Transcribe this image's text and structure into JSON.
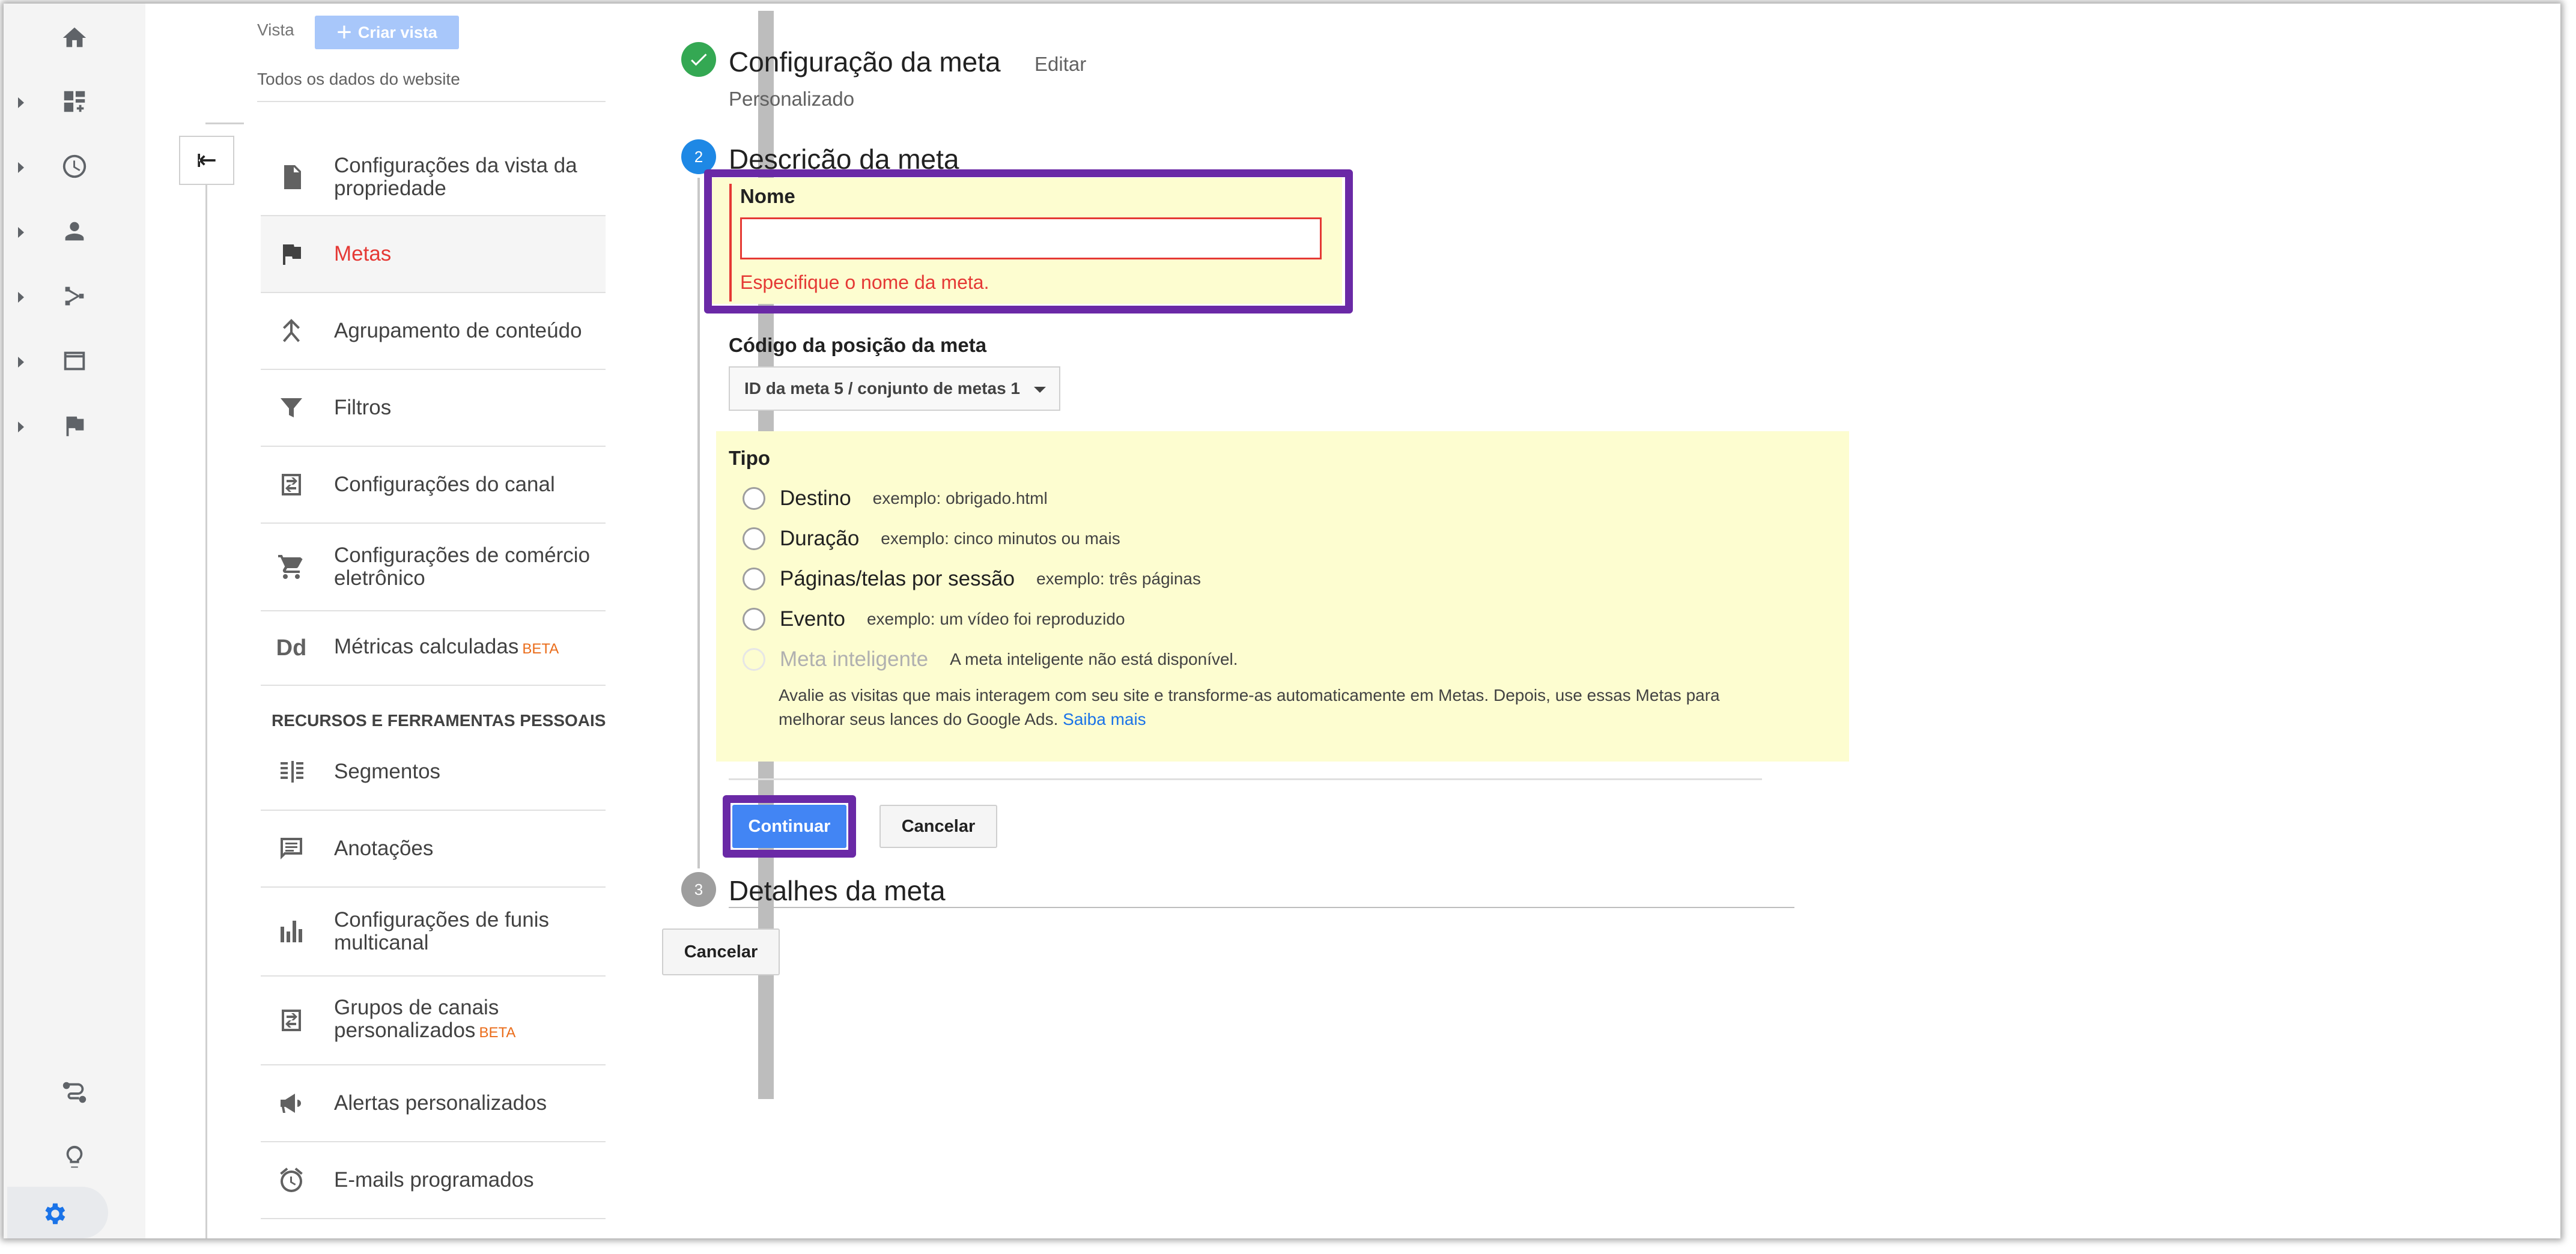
{
  "rail": {
    "icons": [
      "home-icon",
      "dashboard-icon",
      "clock-icon",
      "person-icon",
      "acquisition-icon",
      "behavior-icon",
      "flag-icon"
    ],
    "bottom_icons": [
      "route-icon",
      "lightbulb-icon",
      "gear-icon"
    ]
  },
  "admin": {
    "vista_label": "Vista",
    "criar_vista": "Criar vista",
    "view_name": "Todos os dados do website",
    "nav": [
      {
        "label": "Configurações da vista da propriedade",
        "icon": "document-icon"
      },
      {
        "label": "Metas",
        "icon": "flag-icon",
        "selected": true
      },
      {
        "label": "Agrupamento de conteúdo",
        "icon": "content-grouping-icon"
      },
      {
        "label": "Filtros",
        "icon": "filter-icon"
      },
      {
        "label": "Configurações do canal",
        "icon": "channel-icon"
      },
      {
        "label": "Configurações de comércio eletrônico",
        "icon": "cart-icon"
      },
      {
        "label": "Métricas calculadas",
        "icon": "dd-icon",
        "badge": "BETA"
      }
    ],
    "section_heading": "RECURSOS E FERRAMENTAS PESSOAIS",
    "personal": [
      {
        "label": "Segmentos",
        "icon": "segments-icon"
      },
      {
        "label": "Anotações",
        "icon": "annotations-icon"
      },
      {
        "label": "Configurações de funis multicanal",
        "icon": "bar-chart-icon"
      },
      {
        "label": "Grupos de canais personalizados",
        "icon": "channel-groups-icon",
        "badge": "BETA"
      },
      {
        "label": "Alertas personalizados",
        "icon": "megaphone-icon"
      },
      {
        "label": "E-mails programados",
        "icon": "alarm-clock-icon"
      }
    ]
  },
  "steps": {
    "step1": {
      "title": "Configuração da meta",
      "edit": "Editar",
      "subtitle": "Personalizado"
    },
    "step2": {
      "number": "2",
      "title": "Descrição da meta"
    },
    "step3": {
      "number": "3",
      "title": "Detalhes da meta"
    }
  },
  "form": {
    "nome_label": "Nome",
    "nome_value": "",
    "nome_error": "Especifique o nome da meta.",
    "codigo_label": "Código da posição da meta",
    "codigo_value": "ID da meta 5 / conjunto de metas 1",
    "tipo_label": "Tipo",
    "tipos": [
      {
        "label": "Destino",
        "example": "exemplo: obrigado.html"
      },
      {
        "label": "Duração",
        "example": "exemplo: cinco minutos ou mais"
      },
      {
        "label": "Páginas/telas por sessão",
        "example": "exemplo: três páginas"
      },
      {
        "label": "Evento",
        "example": "exemplo: um vídeo foi reproduzido"
      },
      {
        "label": "Meta inteligente",
        "example": "A meta inteligente não está disponível.",
        "disabled": true
      }
    ],
    "meta_inteligente_desc": "Avalie as visitas que mais interagem com seu site e transforme-as automaticamente em Metas. Depois, use essas Metas para melhorar seus lances do Google Ads.",
    "saiba_mais": "Saiba mais",
    "continuar": "Continuar",
    "cancelar": "Cancelar",
    "cancelar_bottom": "Cancelar"
  },
  "colors": {
    "highlight": "#6a29a6",
    "error": "#e53935",
    "primary": "#4285f4",
    "panel": "#fdfdd0"
  }
}
